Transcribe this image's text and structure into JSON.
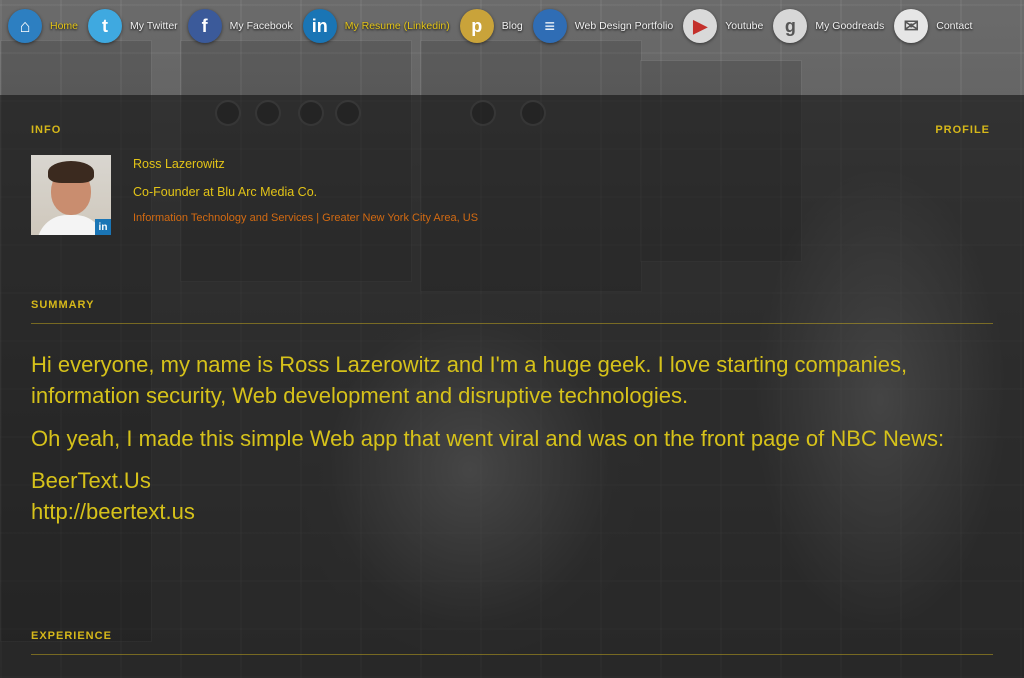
{
  "nav": {
    "items": [
      {
        "label": "Home",
        "icon": "home-icon",
        "color": "#2d7fc1",
        "glyph": "⌂",
        "active": true
      },
      {
        "label": "My Twitter",
        "icon": "twitter-icon",
        "color": "#3fa9e0",
        "glyph": "t",
        "active": false
      },
      {
        "label": "My Facebook",
        "icon": "facebook-icon",
        "color": "#3b5a9a",
        "glyph": "f",
        "active": false
      },
      {
        "label": "My Resume (Linkedin)",
        "icon": "linkedin-icon",
        "color": "#1a75b5",
        "glyph": "in",
        "active": true
      },
      {
        "label": "Blog",
        "icon": "blog-icon",
        "color": "#c9a33a",
        "glyph": "p",
        "active": false
      },
      {
        "label": "Web Design Portfolio",
        "icon": "portfolio-icon",
        "color": "#2f6db5",
        "glyph": "≡",
        "active": false
      },
      {
        "label": "Youtube",
        "icon": "youtube-icon",
        "color": "#d9d9d9",
        "glyph": "▶",
        "active": false
      },
      {
        "label": "My Goodreads",
        "icon": "goodreads-icon",
        "color": "#d7d7d7",
        "glyph": "g",
        "active": false
      },
      {
        "label": "Contact",
        "icon": "mail-icon",
        "color": "#e6e6e6",
        "glyph": "✉",
        "active": false
      }
    ]
  },
  "info": {
    "label": "INFO",
    "profile_link": "PROFILE",
    "name": "Ross Lazerowitz",
    "headline": "Co-Founder at Blu Arc Media Co.",
    "meta": "Information Technology and Services | Greater New York City Area, US",
    "badge": "in"
  },
  "summary": {
    "label": "SUMMARY",
    "para1": "Hi everyone, my name is Ross Lazerowitz and I'm a huge geek. I love starting companies, information security, Web development and disruptive technologies.",
    "para2": "Oh yeah, I made this simple Web app that went viral and was on the front page of NBC News:",
    "link_title": "BeerText.Us",
    "link_url": "http://beertext.us"
  },
  "experience": {
    "label": "EXPERIENCE"
  },
  "colors": {
    "accent": "#e3c417",
    "meta": "#d26a12"
  }
}
